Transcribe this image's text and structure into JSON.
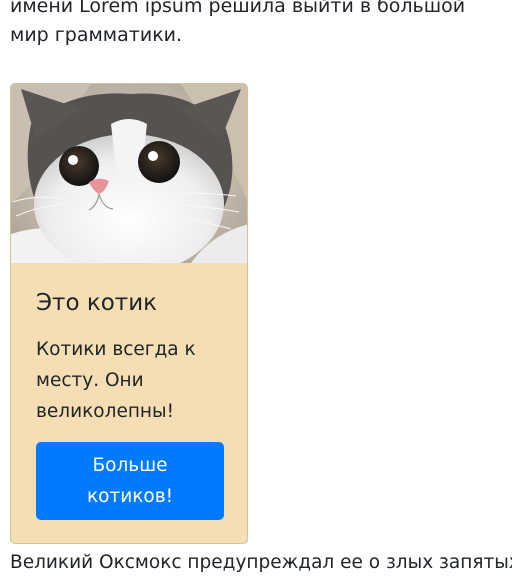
{
  "intro_text": "имени Lorem ipsum решила выйти в большой мир грамматики.",
  "card": {
    "image_alt": "cat-photo",
    "title": "Это котик",
    "text": "Котики всегда к месту. Они великолепны!",
    "button_label": "Больше котиков!",
    "background": "#f5deb3",
    "button_color": "#007bff"
  },
  "outro_text": "Великий Оксмокс предупреждал ее о злых запятых,"
}
